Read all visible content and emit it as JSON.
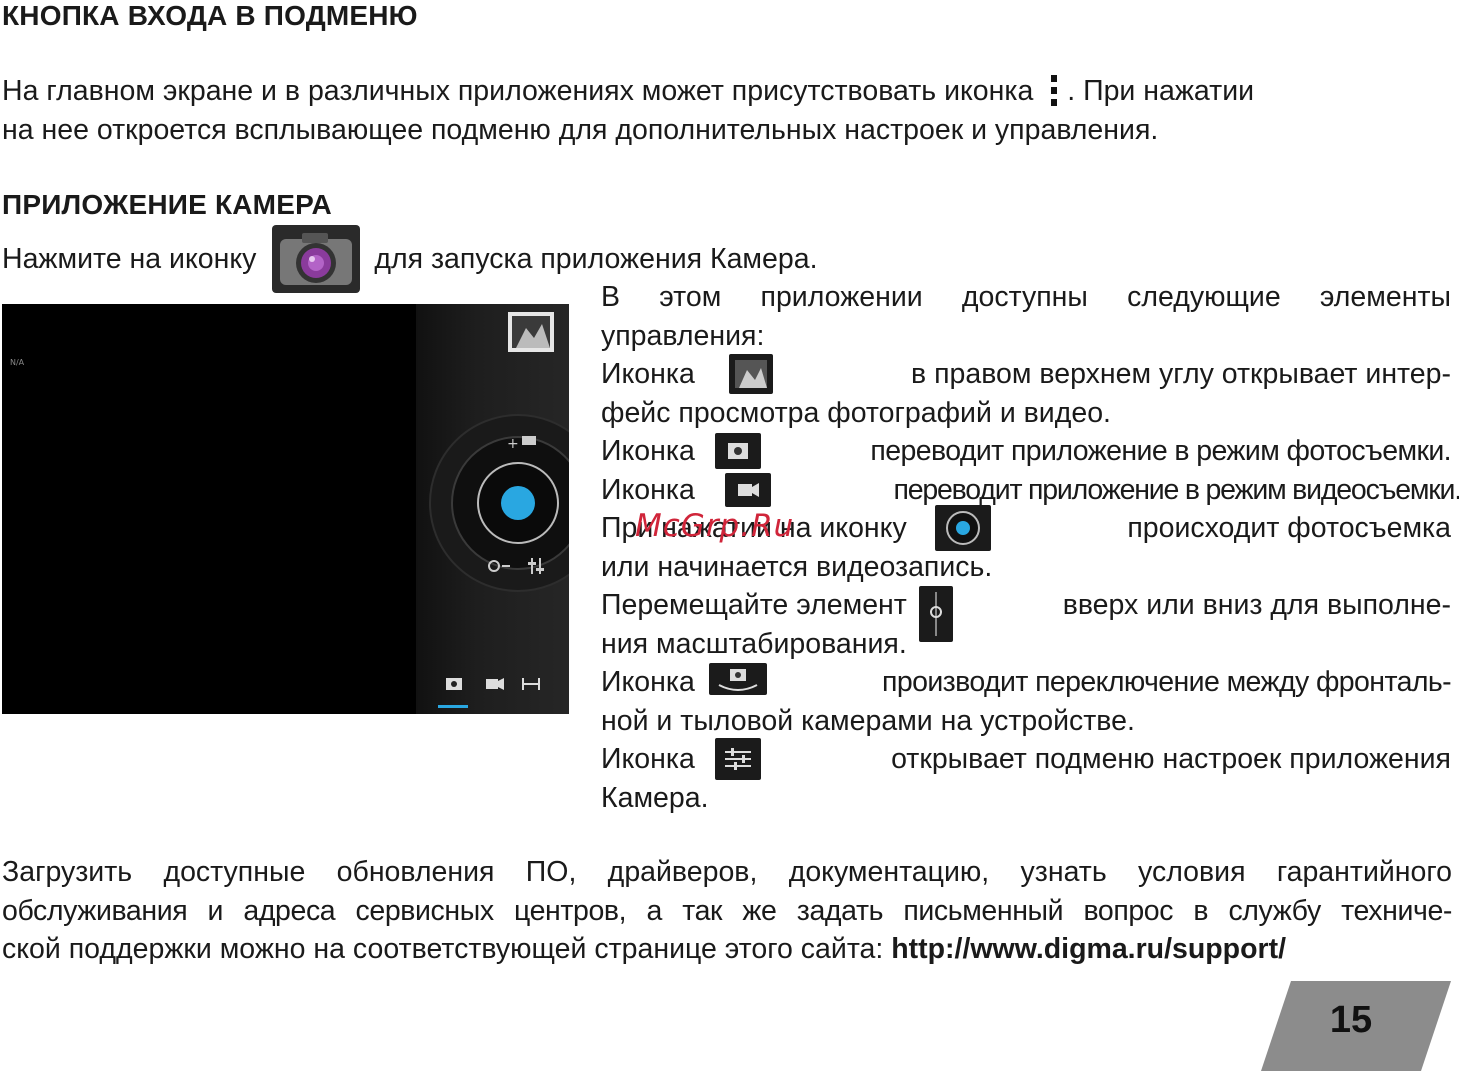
{
  "section1": {
    "title": "КНОПКА ВХОДА В ПОДМЕНЮ",
    "text_a": "На главном экране и в различных приложениях может присутствовать иконка",
    "text_b": ". При нажатии",
    "line2": "на нее откроется всплывающее подменю для дополнительных настроек и управления."
  },
  "section2": {
    "title": "ПРИЛОЖЕНИЕ КАМЕРА",
    "launch_a": "Нажмите на иконку",
    "launch_b": "для запуска приложения Камера."
  },
  "camera_screen": {
    "corner_label": "N/A"
  },
  "desc": {
    "l1": "В этом приложении доступны следующие элементы",
    "l2": "управления:",
    "l3a": "Иконка",
    "l3b": "в правом верхнем углу открывает интер-",
    "l4": "фейс просмотра фотографий и видео.",
    "l5a": "Иконка",
    "l5b": "переводит приложение в режим фотосъемки.",
    "l6a": "Иконка",
    "l6b": "переводит приложение в режим видеосъемки.",
    "l7a": "При нажатии на иконку",
    "l7b": "происходит фотосъемка",
    "l8": "или начинается видеозапись.",
    "l9a": "Перемещайте элемент",
    "l9b": "вверх или вниз для выполне-",
    "l10": "ния масштабирования.",
    "l11a": "Иконка",
    "l11b": "производит переключение между фронталь-",
    "l12": "ной и тыловой камерами на устройстве.",
    "l13a": "Иконка",
    "l13b": "открывает подменю настроек приложения",
    "l14": "Камера."
  },
  "watermark": "McGrp.Ru",
  "footer": {
    "l1": "Загрузить доступные обновления ПО, драйверов, документацию, узнать условия гарантийного",
    "l2": "обслуживания и адреса сервисных центров, а так же задать письменный вопрос в службу техниче-",
    "l3a": "ской поддержки можно на соответствующей странице этого сайта: ",
    "l3url": "http://www.digma.ru/support/"
  },
  "page_number": "15",
  "colors": {
    "accent": "#29a7e1",
    "page_tab": "#8c8c8c",
    "watermark": "#d0253a"
  },
  "icons": [
    "menu-dots-icon",
    "camera-app-icon",
    "gallery-icon",
    "photo-mode-icon",
    "video-mode-icon",
    "shutter-icon",
    "zoom-slider-icon",
    "switch-camera-icon",
    "settings-sliders-icon"
  ]
}
